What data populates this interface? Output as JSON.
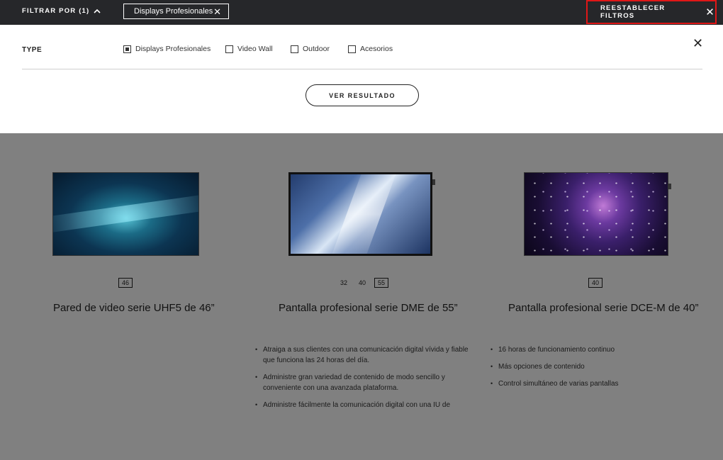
{
  "topbar": {
    "filter_label": "FILTRAR POR (1)",
    "active_chip": "Displays Profesionales",
    "reset_label": "REESTABLECER FILTROS"
  },
  "filter_panel": {
    "group_label": "TYPE",
    "options": [
      {
        "label": "Displays Profesionales",
        "checked": true
      },
      {
        "label": "Video Wall",
        "checked": false
      },
      {
        "label": "Outdoor",
        "checked": false
      },
      {
        "label": "Acesorios",
        "checked": false
      }
    ],
    "submit_label": "VER RESULTADO"
  },
  "products": [
    {
      "name": "Pared de video serie UHF5 de 46”",
      "sizes": [
        {
          "label": "46",
          "active": true
        }
      ],
      "features": []
    },
    {
      "name": "Pantalla profesional serie DME de 55”",
      "sizes": [
        {
          "label": "32",
          "active": false
        },
        {
          "label": "40",
          "active": false
        },
        {
          "label": "55",
          "active": true
        }
      ],
      "features": [
        "Atraiga a sus clientes con una comunicación digital vívida y fiable que funciona las 24 horas del día.",
        "Administre gran variedad de contenido de modo sencillo y conveniente con una avanzada plataforma.",
        "Administre fácilmente la comunicación digital con una IU de"
      ]
    },
    {
      "name": "Pantalla profesional serie DCE-M de 40”",
      "sizes": [
        {
          "label": "40",
          "active": true
        }
      ],
      "features": [
        "16 horas de funcionamiento continuo",
        "Más opciones de contenido",
        "Control simultáneo de varias pantallas"
      ]
    }
  ],
  "colors": {
    "topbar_bg": "#26272a",
    "overlay_bg": "#808080",
    "reset_highlight": "#e01717"
  }
}
